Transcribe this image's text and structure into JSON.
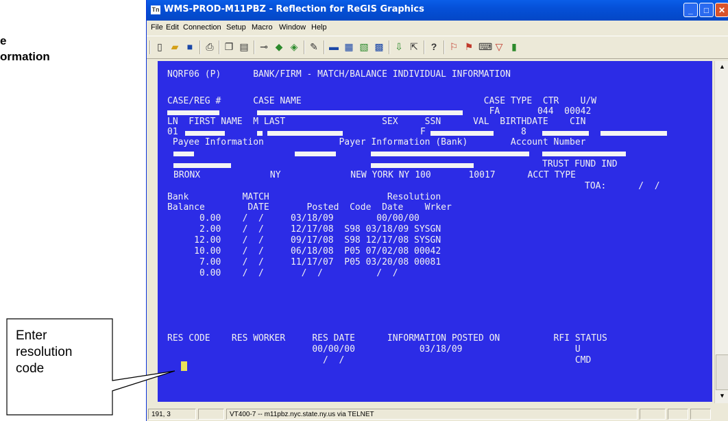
{
  "side_heading": {
    "line1": "e",
    "line2": "ormation"
  },
  "window": {
    "title": "WMS-PROD-M11PBZ - Reflection for ReGIS Graphics",
    "app_icon": "Tn",
    "buttons": {
      "minimize": "_",
      "maximize": "□",
      "close": "✕"
    }
  },
  "menu": [
    "File",
    "Edit",
    "Connection",
    "Setup",
    "Macro",
    "Window",
    "Help"
  ],
  "toolbar_icons": [
    "new-document-icon",
    "open-folder-icon",
    "save-icon",
    "print-icon",
    "copy-icon",
    "paste-icon",
    "connect-icon",
    "send-icon",
    "receive-icon",
    "script-icon",
    "setup-icon",
    "display-icon",
    "keyboard-icon",
    "colors-icon",
    "transfer-icon",
    "pointer-icon",
    "help-icon",
    "macro-record-icon",
    "macro-play-icon",
    "macro-edit-icon",
    "filter-icon",
    "exit-icon"
  ],
  "terminal": {
    "header": "NQRF06 (P)      BANK/FIRM - MATCH/BALANCE INDIVIDUAL INFORMATION",
    "case_labels": "CASE/REG #      CASE NAME                                  CASE TYPE  CTR    U/W",
    "case_values": "                                                            FA       044  00042",
    "person_labels": "LN  FIRST NAME  M LAST                  SEX     SSN      VAL  BIRTHDATE    CIN",
    "person_ln": "01",
    "person_sex": "F",
    "person_val": "8",
    "payee_labels": " Payee Information              Payer Information (Bank)        Account Number",
    "trust_fund": "TRUST FUND IND",
    "city_line": "BRONX             NY             NEW YORK NY 100       10017      ACCT TYPE",
    "toa_line": "TOA:      /  /",
    "col_header_1": "Bank          MATCH                      Resolution",
    "col_header_2": "Balance        DATE       Posted  Code  Date    Wrker",
    "rows": [
      "      0.00    /  /     03/18/09        00/00/00",
      "      2.00    /  /     12/17/08  S98 03/18/09 SYSGN",
      "     12.00    /  /     09/17/08  S98 12/17/08 SYSGN",
      "     10.00    /  /     06/18/08  P05 07/02/08 00042",
      "      7.00    /  /     11/17/07  P05 03/20/08 00081",
      "      0.00    /  /       /  /          /  /"
    ],
    "res_labels": "RES CODE    RES WORKER     RES DATE      INFORMATION POSTED ON          RFI STATUS",
    "res_values": "                           00/00/00            03/18/09                     U",
    "res_date_blank": "                             /  /                                           CMD"
  },
  "status": {
    "position": "191, 3",
    "connection": "VT400-7 -- m11pbz.nyc.state.ny.us via TELNET"
  },
  "callout": {
    "line1": "Enter",
    "line2": "resolution",
    "line3": "code"
  }
}
